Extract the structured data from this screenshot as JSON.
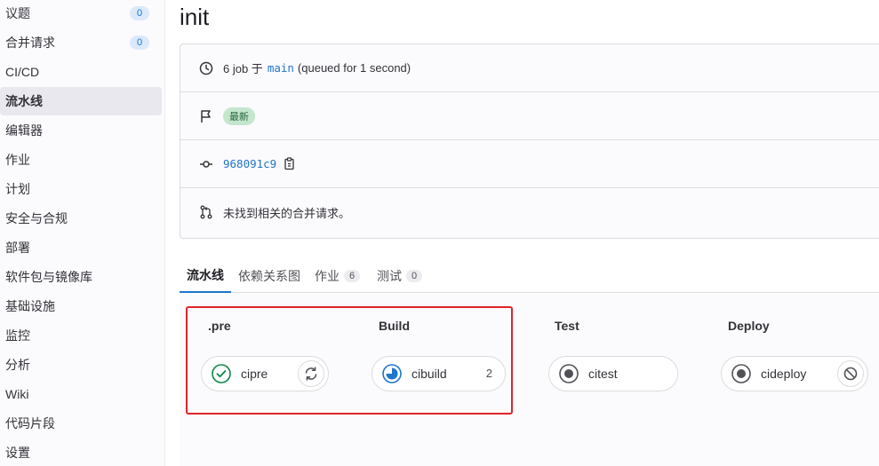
{
  "sidebar": {
    "items": [
      {
        "label": "议题",
        "badge": "0"
      },
      {
        "label": "合并请求",
        "badge": "0"
      },
      {
        "label": "CI/CD"
      },
      {
        "label": "流水线",
        "active": true
      },
      {
        "label": "编辑器"
      },
      {
        "label": "作业"
      },
      {
        "label": "计划"
      },
      {
        "label": "安全与合规"
      },
      {
        "label": "部署"
      },
      {
        "label": "软件包与镜像库"
      },
      {
        "label": "基础设施"
      },
      {
        "label": "监控"
      },
      {
        "label": "分析"
      },
      {
        "label": "Wiki"
      },
      {
        "label": "代码片段"
      },
      {
        "label": "设置"
      }
    ]
  },
  "page": {
    "title": "init"
  },
  "info": {
    "jobs_text": "6 job 于",
    "branch": "main",
    "queued_text": "(queued for 1 second)",
    "latest_badge": "最新",
    "commit_sha": "968091c9",
    "mr_text": "未找到相关的合并请求。"
  },
  "tabs": [
    {
      "label": "流水线",
      "active": true
    },
    {
      "label": "依赖关系图"
    },
    {
      "label": "作业",
      "count": "6"
    },
    {
      "label": "测试",
      "count": "0"
    }
  ],
  "stages": [
    {
      "title": ".pre",
      "job": {
        "name": "cipre",
        "status": "success",
        "action": "retry"
      }
    },
    {
      "title": "Build",
      "job": {
        "name": "cibuild",
        "status": "running",
        "count": "2"
      }
    },
    {
      "title": "Test",
      "job": {
        "name": "citest",
        "status": "created"
      }
    },
    {
      "title": "Deploy",
      "job": {
        "name": "cideploy",
        "status": "created",
        "action": "cancel"
      }
    }
  ],
  "colors": {
    "accent": "#1f75cb",
    "success": "#108548",
    "highlight": "#e0242a",
    "latest_bg": "#c3e6cd"
  }
}
